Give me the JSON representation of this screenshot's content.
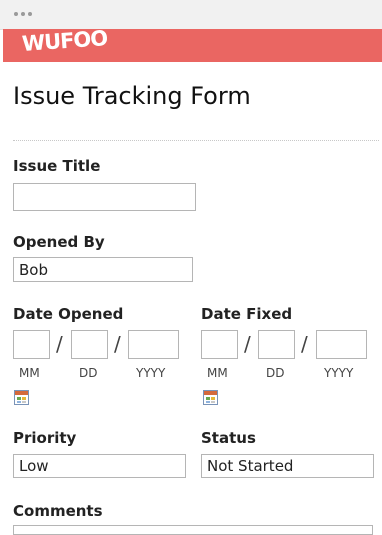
{
  "window": {
    "controls": [
      "dot",
      "dot",
      "dot"
    ]
  },
  "brand": {
    "logo_text": "WUFOO",
    "banner_color": "#ea6662"
  },
  "form": {
    "title": "Issue Tracking Form",
    "issue_title": {
      "label": "Issue Title",
      "value": ""
    },
    "opened_by": {
      "label": "Opened By",
      "value": "Bob"
    },
    "date_opened": {
      "label": "Date Opened",
      "mm": "",
      "dd": "",
      "yyyy": "",
      "sub_mm": "MM",
      "sub_dd": "DD",
      "sub_yyyy": "YYYY",
      "separator": "/"
    },
    "date_fixed": {
      "label": "Date Fixed",
      "mm": "",
      "dd": "",
      "yyyy": "",
      "sub_mm": "MM",
      "sub_dd": "DD",
      "sub_yyyy": "YYYY",
      "separator": "/"
    },
    "priority": {
      "label": "Priority",
      "value": "Low"
    },
    "status": {
      "label": "Status",
      "value": "Not Started"
    },
    "comments": {
      "label": "Comments"
    }
  },
  "icons": {
    "calendar": "calendar-icon"
  }
}
